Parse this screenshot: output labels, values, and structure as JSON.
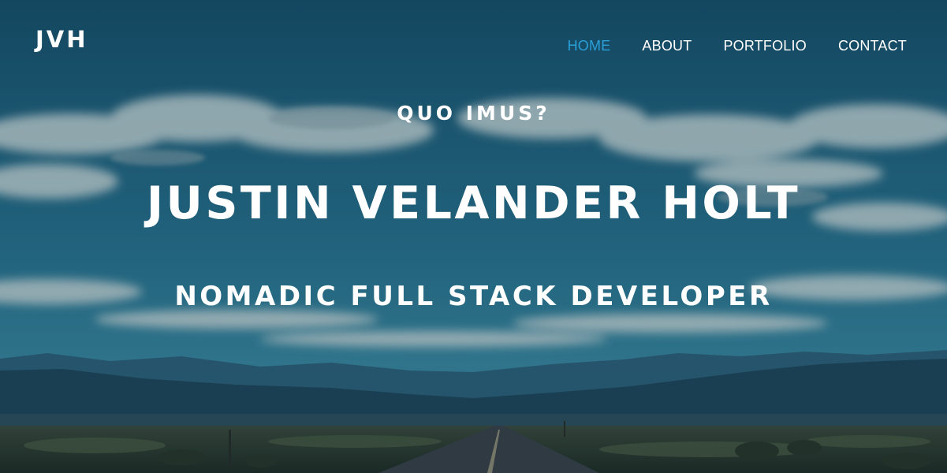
{
  "brand": {
    "logo_text": "JVH"
  },
  "nav": {
    "items": [
      {
        "label": "HOME",
        "active": true
      },
      {
        "label": "ABOUT",
        "active": false
      },
      {
        "label": "PORTFOLIO",
        "active": false
      },
      {
        "label": "CONTACT",
        "active": false
      }
    ]
  },
  "hero": {
    "eyebrow": "QUO IMUS?",
    "name": "JUSTIN VELANDER HOLT",
    "subtitle": "NOMADIC FULL STACK DEVELOPER"
  },
  "colors": {
    "nav_active": "#2a9fd8",
    "text": "#ffffff",
    "sky_top": "#1b5f80",
    "sky_bottom": "#2f7f9c",
    "mountains": "#234d62",
    "ground": "#2a3a28"
  }
}
